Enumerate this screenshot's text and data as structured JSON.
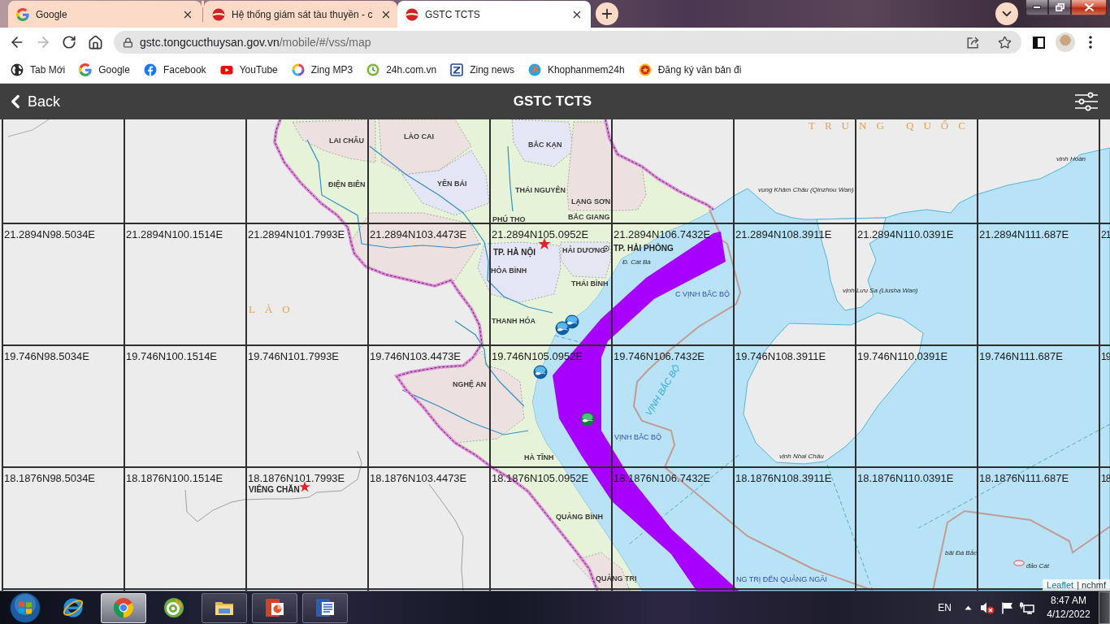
{
  "browser": {
    "tabs": [
      {
        "title": "Google",
        "kind": "google",
        "selected": false
      },
      {
        "title": "Hệ thống giám sát tàu thuyền - c",
        "kind": "gstc",
        "selected": false
      },
      {
        "title": "GSTC TCTS",
        "kind": "gstc",
        "selected": true
      }
    ],
    "nav_buttons": [
      {
        "kind": "back",
        "disabled": false
      },
      {
        "kind": "forward",
        "disabled": true
      },
      {
        "kind": "reload",
        "disabled": false
      },
      {
        "kind": "home",
        "disabled": false
      }
    ],
    "address": {
      "domain": "gstc.tongcucthuysan.gov.vn",
      "path": "/mobile/#/vss/map"
    },
    "bookmarks": [
      {
        "label": "Tab Mới",
        "kind": "globe"
      },
      {
        "label": "Google",
        "kind": "google"
      },
      {
        "label": "Facebook",
        "kind": "facebook"
      },
      {
        "label": "YouTube",
        "kind": "youtube"
      },
      {
        "label": "Zing MP3",
        "kind": "disc"
      },
      {
        "label": "24h.com.vn",
        "kind": "clock"
      },
      {
        "label": "Zing news",
        "kind": "zing"
      },
      {
        "label": "Khophanmem24h",
        "kind": "kho"
      },
      {
        "label": "Đăng ký văn bản đi",
        "kind": "emblem"
      }
    ]
  },
  "app_bar": {
    "back": "Back",
    "title": "GSTC TCTS"
  },
  "map": {
    "grid_rows": [
      [
        "21.2894N98.5034E",
        "21.2894N100.1514E",
        "21.2894N101.7993E",
        "21.2894N103.4473E",
        "21.2894N105.0952E",
        "21.2894N106.7432E",
        "21.2894N108.3911E",
        "21.2894N110.0391E",
        "21.2894N111.687E",
        "21"
      ],
      [
        "19.746N98.5034E",
        "19.746N100.1514E",
        "19.746N101.7993E",
        "19.746N103.4473E",
        "19.746N105.0952E",
        "19.746N106.7432E",
        "19.746N108.3911E",
        "19.746N110.0391E",
        "19.746N111.687E",
        "19"
      ],
      [
        "18.1876N98.5034E",
        "18.1876N100.1514E",
        "18.1876N101.7993E",
        "18.1876N103.4473E",
        "18.1876N105.0952E",
        "18.1876N106.7432E",
        "18.1876N108.3911E",
        "18.1876N110.0391E",
        "18.1876N111.687E",
        "18"
      ]
    ],
    "labels": [
      {
        "text": "TRUNG QUỐC",
        "kind": "country"
      },
      {
        "text": "LAI CHÂU",
        "kind": "province"
      },
      {
        "text": "LÀO CAI",
        "kind": "province"
      },
      {
        "text": "BẮC KẠN",
        "kind": "province"
      },
      {
        "text": "vịnh Hoàn",
        "kind": "place"
      },
      {
        "text": "ĐIỆN BIÊN",
        "kind": "province"
      },
      {
        "text": "YÊN BÁI",
        "kind": "province"
      },
      {
        "text": "THÁI NGUYÊN",
        "kind": "province"
      },
      {
        "text": "vụng Khâm Châu (Qinzhou Wan)",
        "kind": "place"
      },
      {
        "text": "LẠNG SƠN",
        "kind": "province"
      },
      {
        "text": "PHÚ THỌ",
        "kind": "province"
      },
      {
        "text": "BẮC GIANG",
        "kind": "province"
      },
      {
        "text": "TP. HÀ NỘI",
        "kind": "city"
      },
      {
        "text": "HẢI DƯƠNG",
        "kind": "province"
      },
      {
        "text": "TP. HẢI PHÒNG",
        "kind": "city"
      },
      {
        "text": "HÒA BÌNH",
        "kind": "province"
      },
      {
        "text": "Đ. Cát Bà",
        "kind": "place"
      },
      {
        "text": "THÁI BÌNH",
        "kind": "province"
      },
      {
        "text": "C VỊNH BẮC BỘ",
        "kind": "sea"
      },
      {
        "text": "vịnh Lưu Sa (Liusha Wan)",
        "kind": "place"
      },
      {
        "text": "LÀO",
        "kind": "country"
      },
      {
        "text": "THANH HÓA",
        "kind": "province"
      },
      {
        "text": "VỊNH BẮC BỘ",
        "kind": "boundary"
      },
      {
        "text": "NGHỆ AN",
        "kind": "province"
      },
      {
        "text": "VỊNH BẮC BỘ",
        "kind": "sea"
      },
      {
        "text": "HÀ TĨNH",
        "kind": "province"
      },
      {
        "text": "vịnh Nhai Châu",
        "kind": "place"
      },
      {
        "text": "VIÊNG CHĂN",
        "kind": "city"
      },
      {
        "text": "QUẢNG BÌNH",
        "kind": "province"
      },
      {
        "text": "bãi Đá Bắc",
        "kind": "place"
      },
      {
        "text": "đảo Cát",
        "kind": "place"
      },
      {
        "text": "QUẢNG TRỊ",
        "kind": "province"
      },
      {
        "text": "NG TRỊ ĐẾN QUẢNG NGÃI",
        "kind": "sea"
      }
    ],
    "attribution": {
      "link": "Leaflet",
      "text": "| nchmf"
    }
  },
  "taskbar": {
    "apps": [
      {
        "kind": "ie",
        "running": false,
        "selected": false
      },
      {
        "kind": "chrome",
        "running": true,
        "selected": true
      },
      {
        "kind": "coccoc",
        "running": false,
        "selected": false
      },
      {
        "kind": "explorer",
        "running": true,
        "selected": false
      },
      {
        "kind": "powerpoint",
        "running": true,
        "selected": false
      },
      {
        "kind": "word",
        "running": true,
        "selected": false
      }
    ],
    "language": "EN",
    "time": "8:47 AM",
    "date": "4/12/2022"
  }
}
